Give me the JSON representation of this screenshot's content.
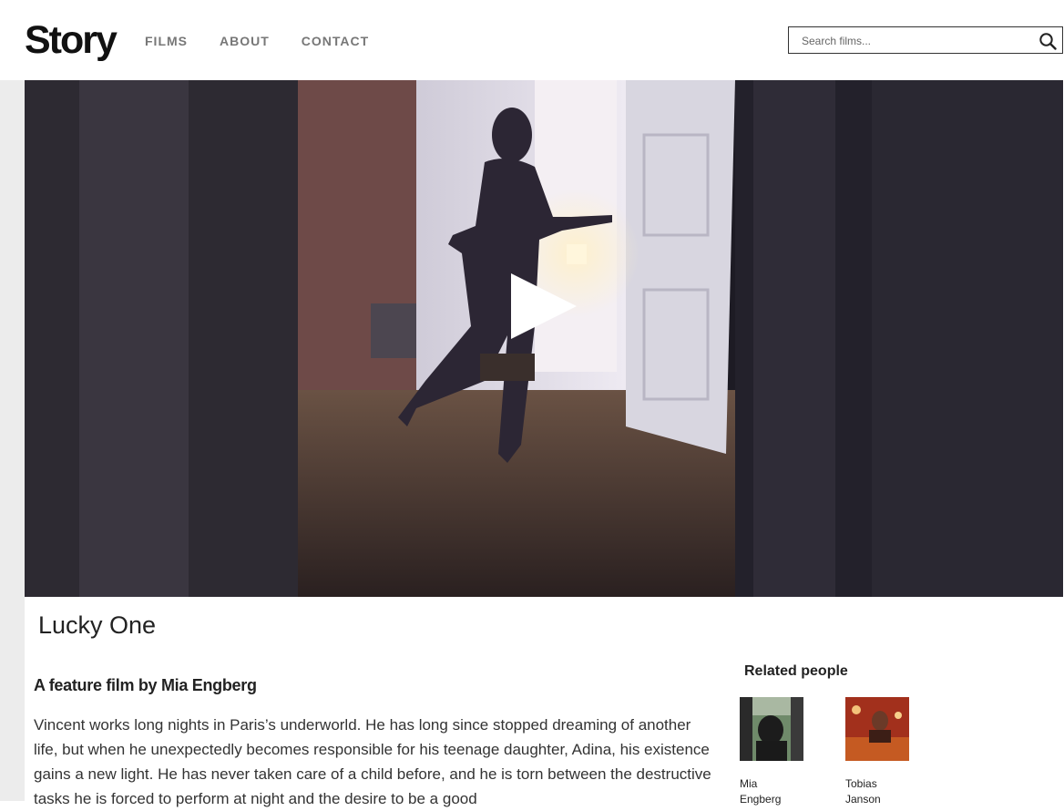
{
  "header": {
    "logo": "Story",
    "nav": [
      "FILMS",
      "ABOUT",
      "CONTACT"
    ],
    "search_placeholder": "Search films..."
  },
  "video": {
    "play_icon": "play-icon"
  },
  "film": {
    "title": "Lucky One",
    "subtitle": "A feature film by Mia Engberg",
    "description": "Vincent works long nights in Paris’s underworld. He has long since stopped dreaming of another life, but when he unexpectedly becomes responsible for his teenage daughter, Adina, his existence gains a new light. He has never taken care of a child before, and he is torn between the destructive tasks he is forced to perform at night and the desire to be a good"
  },
  "related": {
    "title": "Related people",
    "people": [
      {
        "name": "Mia Engberg"
      },
      {
        "name": "Tobias Janson"
      }
    ]
  },
  "colors": {
    "nav_text": "#777777",
    "leftbar": "#ececec"
  }
}
